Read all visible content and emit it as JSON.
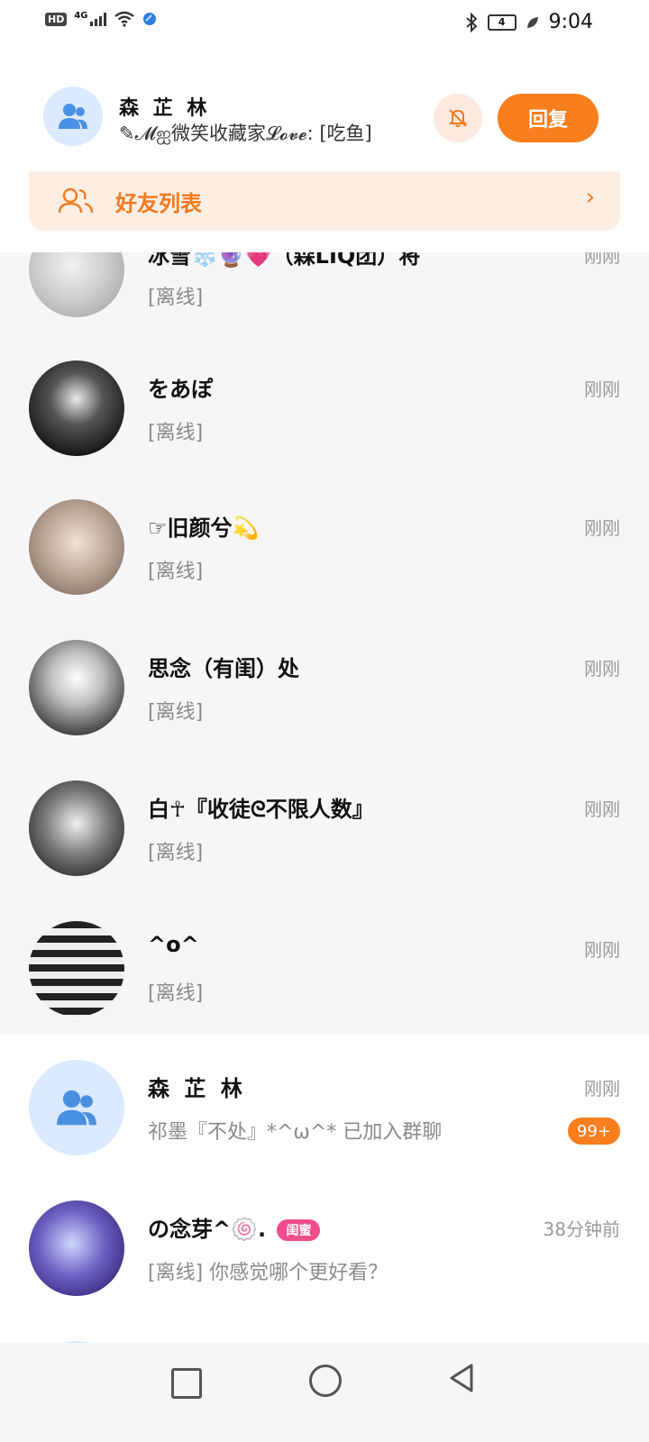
{
  "status_bar": {
    "hd": "HD",
    "network": "4G",
    "battery": "4",
    "time": "9:04"
  },
  "header": {
    "group_name": "森 芷 林",
    "last_message": "✎𝓜ஐ微笑收藏家𝓛𝓸𝓿𝓮: [吃鱼]",
    "reply_label": "回复",
    "friend_list_label": "好友列表"
  },
  "conversations": [
    {
      "name": "冰雪❄️🔮💗（森LIQ团）将",
      "message": "[离线]",
      "time": "刚刚"
    },
    {
      "name": "をあぽ",
      "message": "[离线]",
      "time": "刚刚"
    },
    {
      "name": "☞旧颜兮💫",
      "message": "[离线]",
      "time": "刚刚"
    },
    {
      "name": "思念（有闺）处",
      "message": "[离线]",
      "time": "刚刚"
    },
    {
      "name": "白☥『收徒ᘓ不限人数』",
      "message": "[离线]",
      "time": "刚刚"
    },
    {
      "name": "^o^",
      "message": "[离线]",
      "time": "刚刚"
    },
    {
      "name": "森 芷 林",
      "message": "祁墨『不处』*^ω^* 已加入群聊",
      "time": "刚刚",
      "badge": "99+"
    },
    {
      "name": "の念芽^🍥.",
      "message": "[离线] 你感觉哪个更好看？",
      "time": "38分钟前",
      "tag": "闺蜜"
    }
  ],
  "colors": {
    "accent": "#f97e1d",
    "friend_bar_bg": "#fdeee4",
    "group_avatar_bg": "#dbeafe",
    "group_icon": "#4a90e2"
  }
}
